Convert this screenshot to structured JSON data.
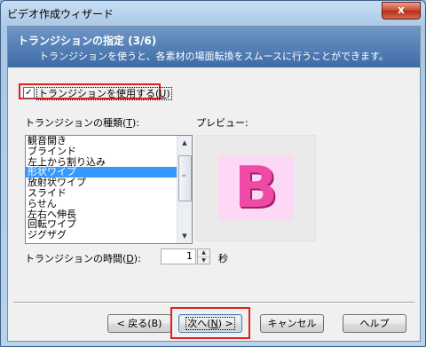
{
  "window": {
    "title": "ビデオ作成ウィザード",
    "close_glyph": "x"
  },
  "header": {
    "title": "トランジションの指定 (3/6)",
    "subtitle": "トランジションを使うと、各素材の場面転換をスムースに行うことができます。"
  },
  "use_transition": {
    "checked": true,
    "check_glyph": "✓",
    "label": "トランジションを使用する(",
    "accel": "U",
    "label_end": ")"
  },
  "transition_type": {
    "label": "トランジションの種類(",
    "accel": "T",
    "label_end": "):",
    "items": [
      "観音開き",
      "ブラインド",
      "左上から割り込み",
      "形状ワイプ",
      "放射状ワイプ",
      "スライド",
      "らせん",
      "左右へ伸長",
      "回転ワイプ",
      "ジグザグ"
    ],
    "selected": "形状ワイプ"
  },
  "preview": {
    "label": "プレビュー:",
    "letter": "B"
  },
  "duration": {
    "label": "トランジションの時間(",
    "accel": "D",
    "label_end": "):",
    "value": "1",
    "unit": "秒"
  },
  "buttons": {
    "back": "< 戻る(B)",
    "next_prefix": "次へ(",
    "next_accel": "N",
    "next_suffix": ") >",
    "cancel": "キャンセル",
    "help": "ヘルプ"
  },
  "icons": {
    "scroll_up": "up-arrow",
    "scroll_down": "down-arrow",
    "spin_up": "up-arrow",
    "spin_down": "down-arrow"
  },
  "colors": {
    "header_band": "#3d6ba6",
    "selection": "#3399ff",
    "highlight": "#e0201e",
    "preview_bg": "#fcd7f6",
    "preview_letter": "#ef4aa5"
  }
}
